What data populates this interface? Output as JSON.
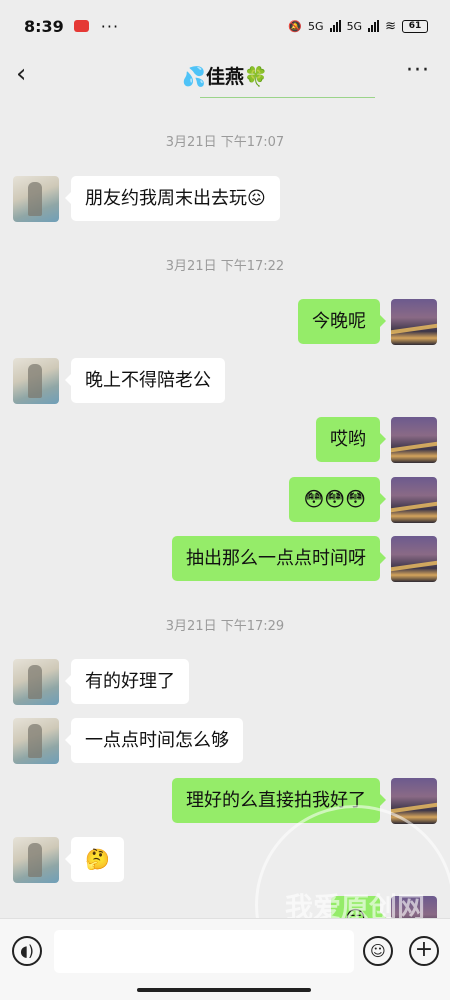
{
  "status_bar": {
    "time": "8:39",
    "app_badge": "GQ",
    "dots": "···",
    "net1": "5G",
    "net2": "5G",
    "battery": "61"
  },
  "header": {
    "title": "💦佳燕🍀",
    "back_icon": "chevron-left",
    "more_icon": "more-dots"
  },
  "timestamps": [
    "3月21日 下午17:07",
    "3月21日 下午17:22",
    "3月21日 下午17:29"
  ],
  "messages": [
    {
      "side": "peer",
      "text": "朋友约我周末出去玩😖"
    },
    {
      "side": "me",
      "text": "今晚呢"
    },
    {
      "side": "peer",
      "text": "晚上不得陪老公"
    },
    {
      "side": "me",
      "text": "哎哟"
    },
    {
      "side": "me",
      "text": "😳😳😳"
    },
    {
      "side": "me",
      "text": "抽出那么一点点时间呀"
    },
    {
      "side": "peer",
      "text": "有的好理了"
    },
    {
      "side": "peer",
      "text": "一点点时间怎么够"
    },
    {
      "side": "me",
      "text": "理好的么直接拍我好了"
    },
    {
      "side": "peer",
      "text": "🤔"
    },
    {
      "side": "me",
      "text": "😏"
    }
  ],
  "watermark": "我爱原创网",
  "input_bar": {
    "voice_icon": "voice-icon",
    "emoji_icon": "emoji-icon",
    "plus_icon": "plus-icon",
    "voice_glyph": "◖)",
    "emoji_glyph": "☺",
    "plus_glyph": "+"
  },
  "colors": {
    "background": "#ededed",
    "my_bubble": "#95ec69",
    "peer_bubble": "#ffffff",
    "timestamp": "#9a9a9a"
  }
}
